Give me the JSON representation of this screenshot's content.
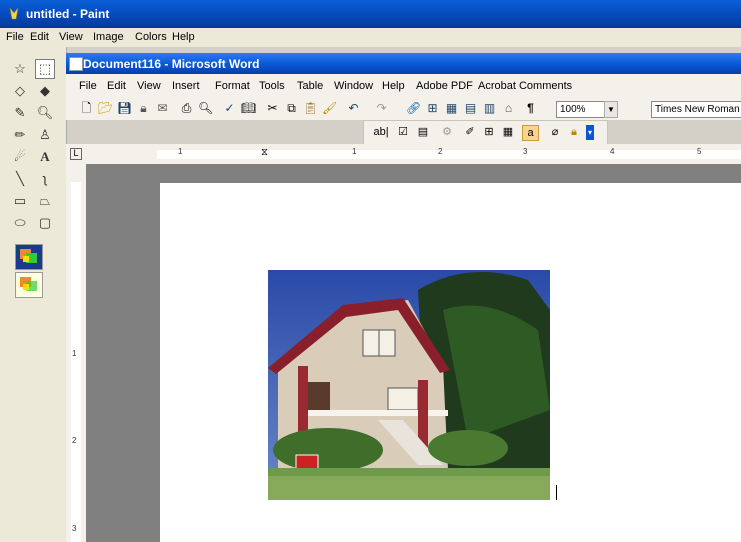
{
  "paint": {
    "title": "untitled - Paint",
    "menu": [
      "File",
      "Edit",
      "View",
      "Image",
      "Colors",
      "Help"
    ]
  },
  "word": {
    "title": "Document116 - Microsoft Word",
    "menu": [
      "File",
      "Edit",
      "View",
      "Insert",
      "Format",
      "Tools",
      "Table",
      "Window",
      "Help",
      "Adobe PDF",
      "Acrobat Comments"
    ],
    "zoom": "100%",
    "font": "Times New Roman",
    "ruler_numbers": [
      "1",
      "1",
      "2",
      "3",
      "4",
      "5"
    ],
    "vruler_numbers": [
      "1",
      "2",
      "3"
    ]
  }
}
